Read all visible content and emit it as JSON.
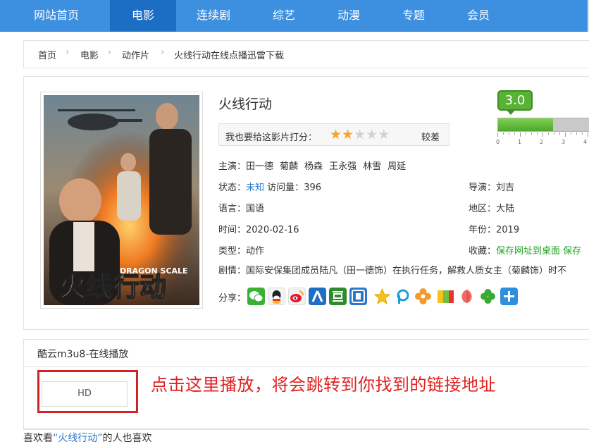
{
  "nav": {
    "items": [
      {
        "label": "网站首页",
        "active": false
      },
      {
        "label": "电影",
        "active": true
      },
      {
        "label": "连续剧",
        "active": false
      },
      {
        "label": "综艺",
        "active": false
      },
      {
        "label": "动漫",
        "active": false
      },
      {
        "label": "专题",
        "active": false
      },
      {
        "label": "会员",
        "active": false
      }
    ]
  },
  "breadcrumb": {
    "items": [
      "首页",
      "电影",
      "动作片",
      "火线行动在线点播迅雷下载"
    ],
    "separator": "›"
  },
  "movie": {
    "title": "火线行动",
    "poster_title_art": "火线行动",
    "poster_subtitle": "DRAGON SCALE",
    "rate_prompt": "我也要给这影片打分：",
    "stars_on": 2,
    "stars_total": 5,
    "rate_word": "较差",
    "score": "3.0",
    "score_fraction": 0.6,
    "score_scale": [
      "0",
      "1",
      "2",
      "3",
      "4"
    ],
    "cast_label": "主演：",
    "cast": [
      "田一德",
      "菊麟",
      "杨森",
      "王永强",
      "林雪",
      "周延"
    ],
    "status_label": "状态：",
    "status_value": "未知",
    "views_label": "访问量：",
    "views_value": "396",
    "director_label": "导演：",
    "director_value": "刘吉",
    "language_label": "语言：",
    "language_value": "国语",
    "region_label": "地区：",
    "region_value": "大陆",
    "date_label": "时间：",
    "date_value": "2020-02-16",
    "year_label": "年份：",
    "year_value": "2019",
    "genre_label": "类型：",
    "genre_value": "动作",
    "fav_label": "收藏：",
    "fav_link1": "保存网址到桌面",
    "fav_link2": "保存",
    "plot_label": "剧情：",
    "plot_value": "国际安保集团成员陆凡（田一德饰）在执行任务，解救人质女主（菊麟饰）时不",
    "share_label": "分享："
  },
  "share_icons": [
    {
      "name": "wechat-icon",
      "glyph": "◉",
      "color": "#3cb034"
    },
    {
      "name": "qq-icon",
      "glyph": "◓",
      "color": "#ffffff"
    },
    {
      "name": "weibo-icon",
      "glyph": "◎",
      "color": "#ffffff"
    },
    {
      "name": "renren-icon",
      "glyph": "人",
      "color": "#1f6ec5"
    },
    {
      "name": "douban-icon",
      "glyph": "豆",
      "color": "#2e8c2e"
    },
    {
      "name": "tieba-icon",
      "glyph": "贴",
      "color": "#2f77c9"
    },
    {
      "name": "qzone-icon",
      "glyph": "★",
      "color": "#ffffff"
    },
    {
      "name": "pengyou-icon",
      "glyph": "P",
      "color": "#ffffff"
    },
    {
      "name": "flower-icon",
      "glyph": "✿",
      "color": "#ffffff"
    },
    {
      "name": "color-blocks-icon",
      "glyph": "",
      "color": "#ffffff"
    },
    {
      "name": "petal-icon",
      "glyph": "",
      "color": "#ffffff"
    },
    {
      "name": "clover-icon",
      "glyph": "♣",
      "color": "#ffffff"
    },
    {
      "name": "plus-share-icon",
      "glyph": "+",
      "color": "#2f8fdc"
    }
  ],
  "play": {
    "source_title": "酷云m3u8-在线播放",
    "hd_label": "HD",
    "note": "点击这里播放，将会跳转到你找到的链接地址"
  },
  "like": {
    "prefix": "喜欢看",
    "highlight": "“火线行动”",
    "suffix": "的人也喜欢"
  },
  "colors": {
    "nav_bg": "#3d8fe0",
    "nav_active": "#1c6ec4",
    "score_green": "#58b335",
    "note_red": "#e02020",
    "link_blue": "#2a78c8",
    "fav_green": "#1fa31f"
  }
}
